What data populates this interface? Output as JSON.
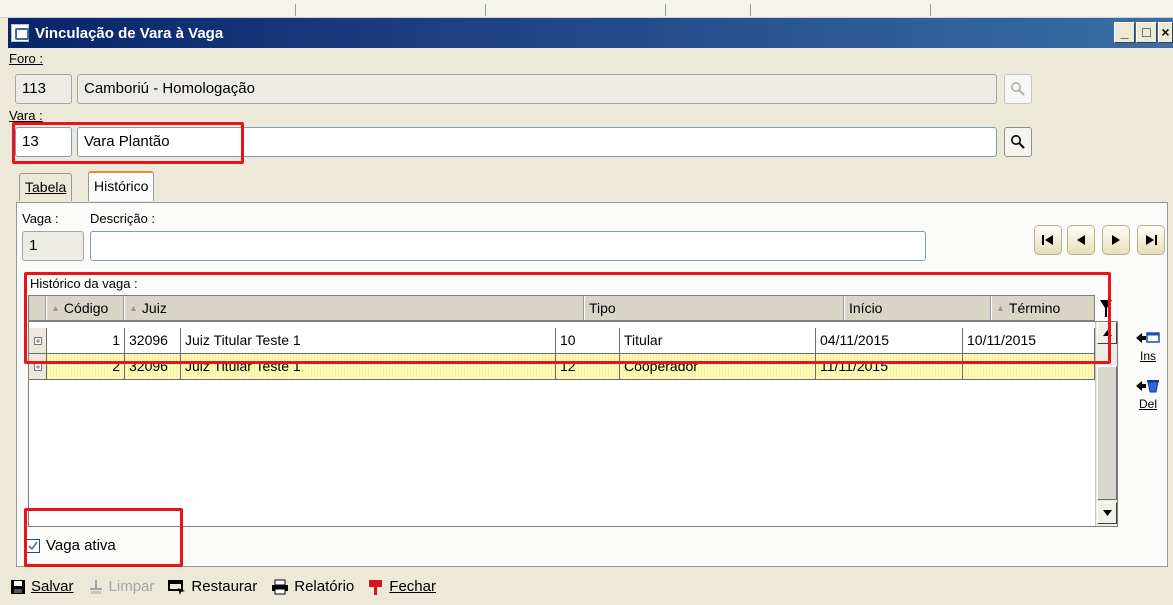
{
  "window": {
    "title": "Vinculação de Vara à Vaga",
    "controls": [
      "_",
      "□",
      "×"
    ]
  },
  "foro": {
    "label": "Foro :",
    "code": "113",
    "name": "Camboriú - Homologação"
  },
  "vara": {
    "label": "Vara :",
    "code": "13",
    "name": "Vara Plantão"
  },
  "tabs": [
    {
      "label": "Tabela",
      "active": false
    },
    {
      "label": "Histórico",
      "active": true
    }
  ],
  "vaga": {
    "label": "Vaga :",
    "value": "1",
    "descricao_label": "Descrição :",
    "descricao_value": ""
  },
  "historico": {
    "label": "Histórico da vaga :",
    "columns": [
      "Código",
      "Juiz",
      "Tipo",
      "Início",
      "Término"
    ],
    "rows": [
      {
        "codigo": "1",
        "juiz_id": "32096",
        "juiz_nome": "Juiz Titular Teste 1",
        "tipo_id": "10",
        "tipo_nome": "Titular",
        "inicio": "04/11/2015",
        "termino": "10/11/2015"
      },
      {
        "codigo": "2",
        "juiz_id": "32096",
        "juiz_nome": "Juiz Titular Teste 1",
        "tipo_id": "12",
        "tipo_nome": "Cooperador",
        "inicio": "11/11/2015",
        "termino": ""
      }
    ]
  },
  "side_actions": {
    "ins": "Ins",
    "del": "Del"
  },
  "vaga_ativa": {
    "label": "Vaga ativa",
    "checked": true
  },
  "toolbar": {
    "salvar": "Salvar",
    "limpar": "Limpar",
    "restaurar": "Restaurar",
    "relatorio": "Relatório",
    "fechar": "Fechar"
  },
  "colors": {
    "title_start": "#0a246a",
    "title_end": "#3a6ea5",
    "selected_row": "#fffbb5",
    "highlight_box": "#e8141b"
  }
}
